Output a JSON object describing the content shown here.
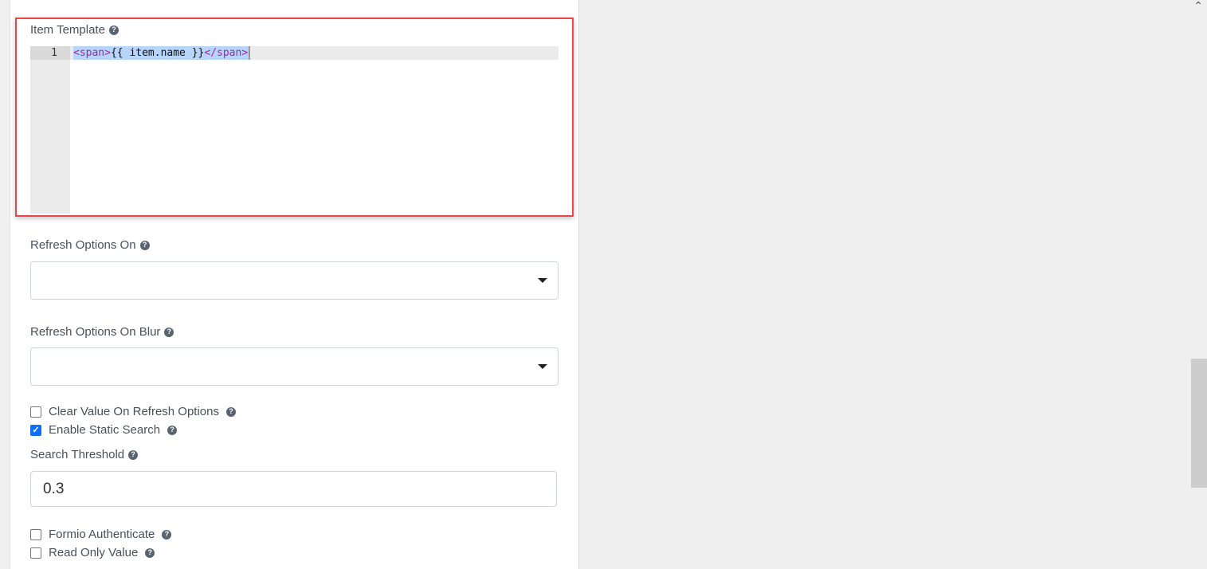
{
  "item_template": {
    "label": "Item Template",
    "help_icon": "question-circle-icon",
    "line_number": "1",
    "code": {
      "open_tag": "<span>",
      "expression": "{{ item.name }}",
      "close_tag": "</span>"
    }
  },
  "refresh_options_on": {
    "label": "Refresh Options On",
    "value": ""
  },
  "refresh_options_on_blur": {
    "label": "Refresh Options On Blur",
    "value": ""
  },
  "checkboxes": [
    {
      "label": "Clear Value On Refresh Options",
      "checked": false
    },
    {
      "label": "Enable Static Search",
      "checked": true
    }
  ],
  "search_threshold": {
    "label": "Search Threshold",
    "value": "0.3"
  },
  "checkboxes2": [
    {
      "label": "Formio Authenticate",
      "checked": false
    },
    {
      "label": "Read Only Value",
      "checked": false
    }
  ],
  "colors": {
    "highlight": "#ef4444",
    "checkbox_checked": "#0d6efd"
  }
}
